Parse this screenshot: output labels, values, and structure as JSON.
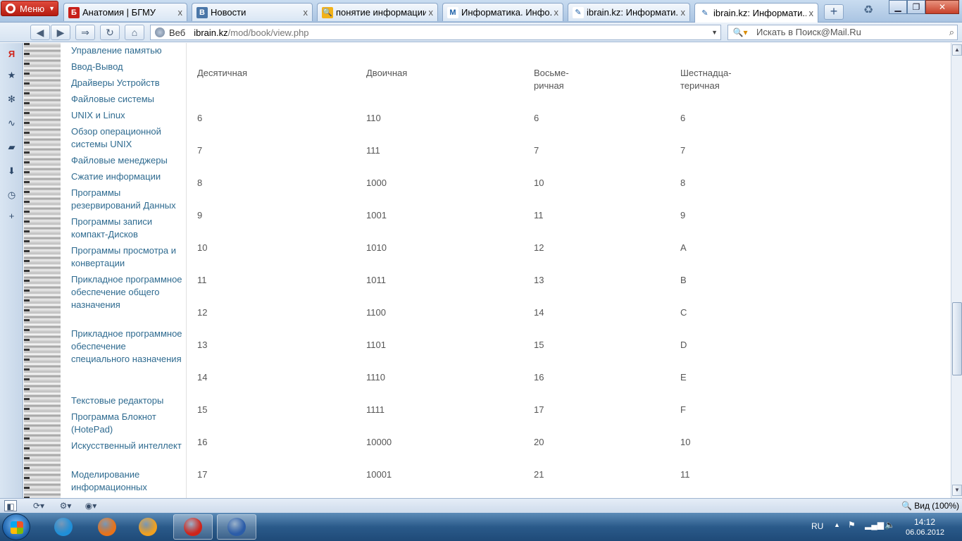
{
  "browser": {
    "menu_label": "Меню",
    "tabs": [
      {
        "label": "Анатомия | БГМУ",
        "icon": "bgmu-favicon-icon",
        "color": "#c7201a",
        "glyph": "Б",
        "active": false
      },
      {
        "label": "Новости",
        "icon": "vk-favicon-icon",
        "color": "#4a76a8",
        "glyph": "В",
        "active": false
      },
      {
        "label": "понятие информации...",
        "icon": "search-favicon-icon",
        "color": "#f2b218",
        "glyph": "🔍",
        "active": false
      },
      {
        "label": "Информатика. Инфо...",
        "icon": "m-favicon-icon",
        "color": "#ffffff",
        "glyph": "M",
        "active": false
      },
      {
        "label": "ibrain.kz: Информати...",
        "icon": "ibrain-favicon-icon",
        "color": "#ffffff",
        "glyph": "✎",
        "active": false
      },
      {
        "label": "ibrain.kz: Информати...",
        "icon": "ibrain-favicon-icon",
        "color": "#ffffff",
        "glyph": "✎",
        "active": true
      }
    ],
    "tab_close_glyph": "x",
    "new_tab_glyph": "+",
    "web_label": "Веб",
    "url_domain": "ibrain.kz",
    "url_path": "/mod/book/view.php",
    "search_placeholder": "Искать в Поиск@Mail.Ru",
    "zoom_label": "Вид (100%)"
  },
  "sidebar_nav": [
    {
      "label": "Управление памятью"
    },
    {
      "label": "Ввод-Вывод"
    },
    {
      "label": "Драйверы Устройств"
    },
    {
      "label": "Файловые системы"
    },
    {
      "label": "UNIX и Linux"
    },
    {
      "label": "Обзор операционной системы UNIX"
    },
    {
      "label": "Файловые менеджеры"
    },
    {
      "label": "Сжатие информации"
    },
    {
      "label": "Программы резервирований Данных"
    },
    {
      "label": "Программы записи компакт-Дисков"
    },
    {
      "label": "Программы просмотра и конвертации"
    },
    {
      "label": "Прикладное программное обеспечение общего назначения"
    },
    {
      "label": "Прикладное программное обеспечение специального назначения"
    },
    {
      "label": "Текстовые редакторы"
    },
    {
      "label": "Программа Блокнот (HotePad)"
    },
    {
      "label": "Искусственный интеллект"
    },
    {
      "label": "Моделирование информационных"
    }
  ],
  "table": {
    "headers": [
      "Десятичная",
      "Двоичная",
      "Восьме-ричная",
      "Шестнадца-теричная"
    ],
    "rows": [
      [
        "6",
        "110",
        "6",
        "6"
      ],
      [
        "7",
        "111",
        "7",
        "7"
      ],
      [
        "8",
        "1000",
        "10",
        "8"
      ],
      [
        "9",
        "1001",
        "11",
        "9"
      ],
      [
        "10",
        "1010",
        "12",
        "A"
      ],
      [
        "11",
        "1011",
        "13",
        "B"
      ],
      [
        "12",
        "1100",
        "14",
        "C"
      ],
      [
        "13",
        "1101",
        "15",
        "D"
      ],
      [
        "14",
        "1110",
        "16",
        "E"
      ],
      [
        "15",
        "1111",
        "17",
        "F"
      ],
      [
        "16",
        "10000",
        "20",
        "10"
      ],
      [
        "17",
        "10001",
        "21",
        "11"
      ]
    ]
  },
  "taskbar": {
    "apps": [
      {
        "name": "ie-icon",
        "color": "#1f8fd8",
        "running": false
      },
      {
        "name": "firefox-icon",
        "color": "#e8731a",
        "running": false
      },
      {
        "name": "media-player-icon",
        "color": "#f0a020",
        "running": false
      },
      {
        "name": "opera-icon",
        "color": "#d0241a",
        "running": true
      },
      {
        "name": "word-icon",
        "color": "#2b5ca8",
        "running": true
      }
    ],
    "language": "RU",
    "time": "14:12",
    "date": "06.06.2012"
  }
}
